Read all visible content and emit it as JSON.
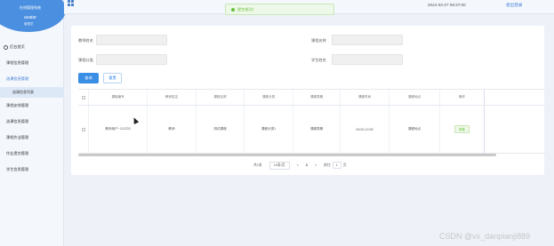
{
  "sidebar": {
    "system_title": "在线管理系统",
    "user_name": "avatar",
    "user_role": "管理员",
    "items": [
      {
        "label": "后台首页",
        "active": false
      },
      {
        "label": "课程信息管理",
        "active": false
      },
      {
        "label": "选课信息管理",
        "active": true
      },
      {
        "label": "选课信息列表",
        "sub": true
      },
      {
        "label": "课程安排管理",
        "active": false
      },
      {
        "label": "选课信息管理",
        "active": false
      },
      {
        "label": "课程作业管理",
        "active": false
      },
      {
        "label": "作业提交管理",
        "active": false
      },
      {
        "label": "学生信息管理",
        "active": false
      }
    ]
  },
  "topbar": {
    "datetime": "2024-03-27 09:37:00",
    "logout": "退出登录"
  },
  "toast": {
    "text": "提交成功!",
    "icon": "success-icon",
    "color": "#67c23a"
  },
  "filters": {
    "teacher_label": "教师姓名",
    "course_name_label": "课程名称",
    "course_category_label": "课程分类",
    "student_name_label": "学生姓名",
    "query_label": "查询",
    "reset_label": "重置"
  },
  "table": {
    "headers": [
      "课程编号",
      "教师姓名",
      "课程名称",
      "课程分类",
      "课程周期",
      "课程时间",
      "课程地点",
      "操作"
    ],
    "rows": [
      {
        "code": "教师用户~112233",
        "teacher": "教师",
        "name": "测试课程",
        "category": "课程分类1",
        "period": "课程周期",
        "time": "09:00-10:30",
        "location": "课程地点",
        "action": "审核"
      }
    ]
  },
  "pager": {
    "total": "共1条",
    "page_size": "10条/页",
    "prev": "<",
    "current": "1",
    "next": ">",
    "jump_label": "前往",
    "jump_value": "1",
    "page_suffix": "页"
  },
  "watermark": "CSDN @vx_danpianji889",
  "colors": {
    "accent": "#3a8ee6",
    "sidebar_bg": "#f4f7fc",
    "logo": "#4a8fe0"
  }
}
